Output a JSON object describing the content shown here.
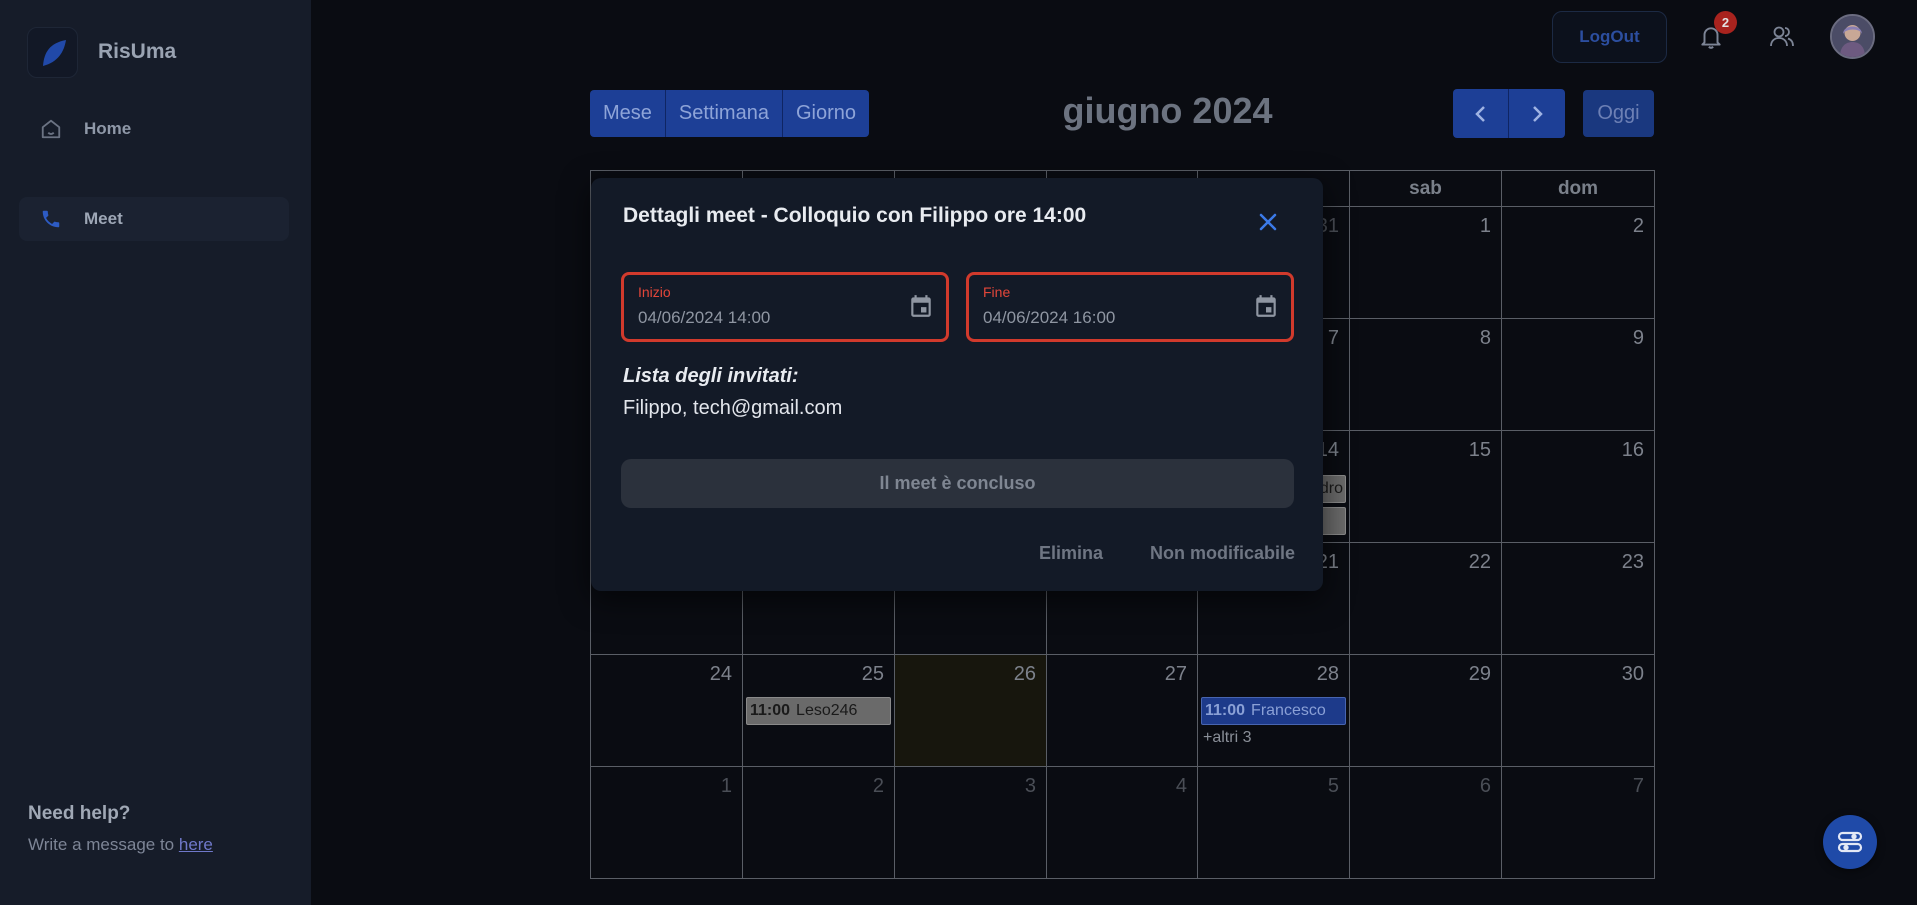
{
  "app": {
    "name": "RisUma"
  },
  "sidebar": {
    "items": [
      {
        "label": "Home",
        "icon": "home-icon"
      },
      {
        "label": "Meet",
        "icon": "phone-icon"
      }
    ],
    "help_title": "Need help?",
    "help_text": "Write a message to ",
    "help_link": "here"
  },
  "topbar": {
    "logout_label": "LogOut",
    "notification_count": "2"
  },
  "calendar": {
    "views": [
      "Mese",
      "Settimana",
      "Giorno"
    ],
    "title": "giugno 2024",
    "today_label": "Oggi",
    "weekday_headers": [
      "",
      "",
      "",
      "",
      "",
      "sab",
      "dom"
    ],
    "weeks": [
      [
        "",
        "",
        "",
        "",
        "31",
        "1",
        "2"
      ],
      [
        "",
        "",
        "",
        "",
        "7",
        "8",
        "9"
      ],
      [
        "",
        "",
        "",
        "",
        "14",
        "15",
        "16"
      ],
      [
        "",
        "",
        "",
        "",
        "21",
        "22",
        "23"
      ],
      [
        "24",
        "25",
        "26",
        "27",
        "28",
        "29",
        "30"
      ],
      [
        "1",
        "2",
        "3",
        "4",
        "5",
        "6",
        "7"
      ]
    ],
    "events": {
      "partial_event_text": "dro",
      "event_25_time": "11:00",
      "event_25_title": "Leso246",
      "event_28_time": "11:00",
      "event_28_title": "Francesco",
      "event_28_more": "+altri 3"
    }
  },
  "modal": {
    "title": "Dettagli meet - Colloquio con Filippo ore 14:00",
    "start_label": "Inizio",
    "start_value": "04/06/2024 14:00",
    "end_label": "Fine",
    "end_value": "04/06/2024 16:00",
    "invited_title": "Lista degli invitati:",
    "invited_list": "Filippo, tech@gmail.com",
    "status": "Il meet è concluso",
    "delete_label": "Elimina",
    "edit_label": "Non modificabile"
  },
  "colors": {
    "accent": "#1d3f96",
    "error": "#d13a2c",
    "badge": "#a8231e"
  }
}
